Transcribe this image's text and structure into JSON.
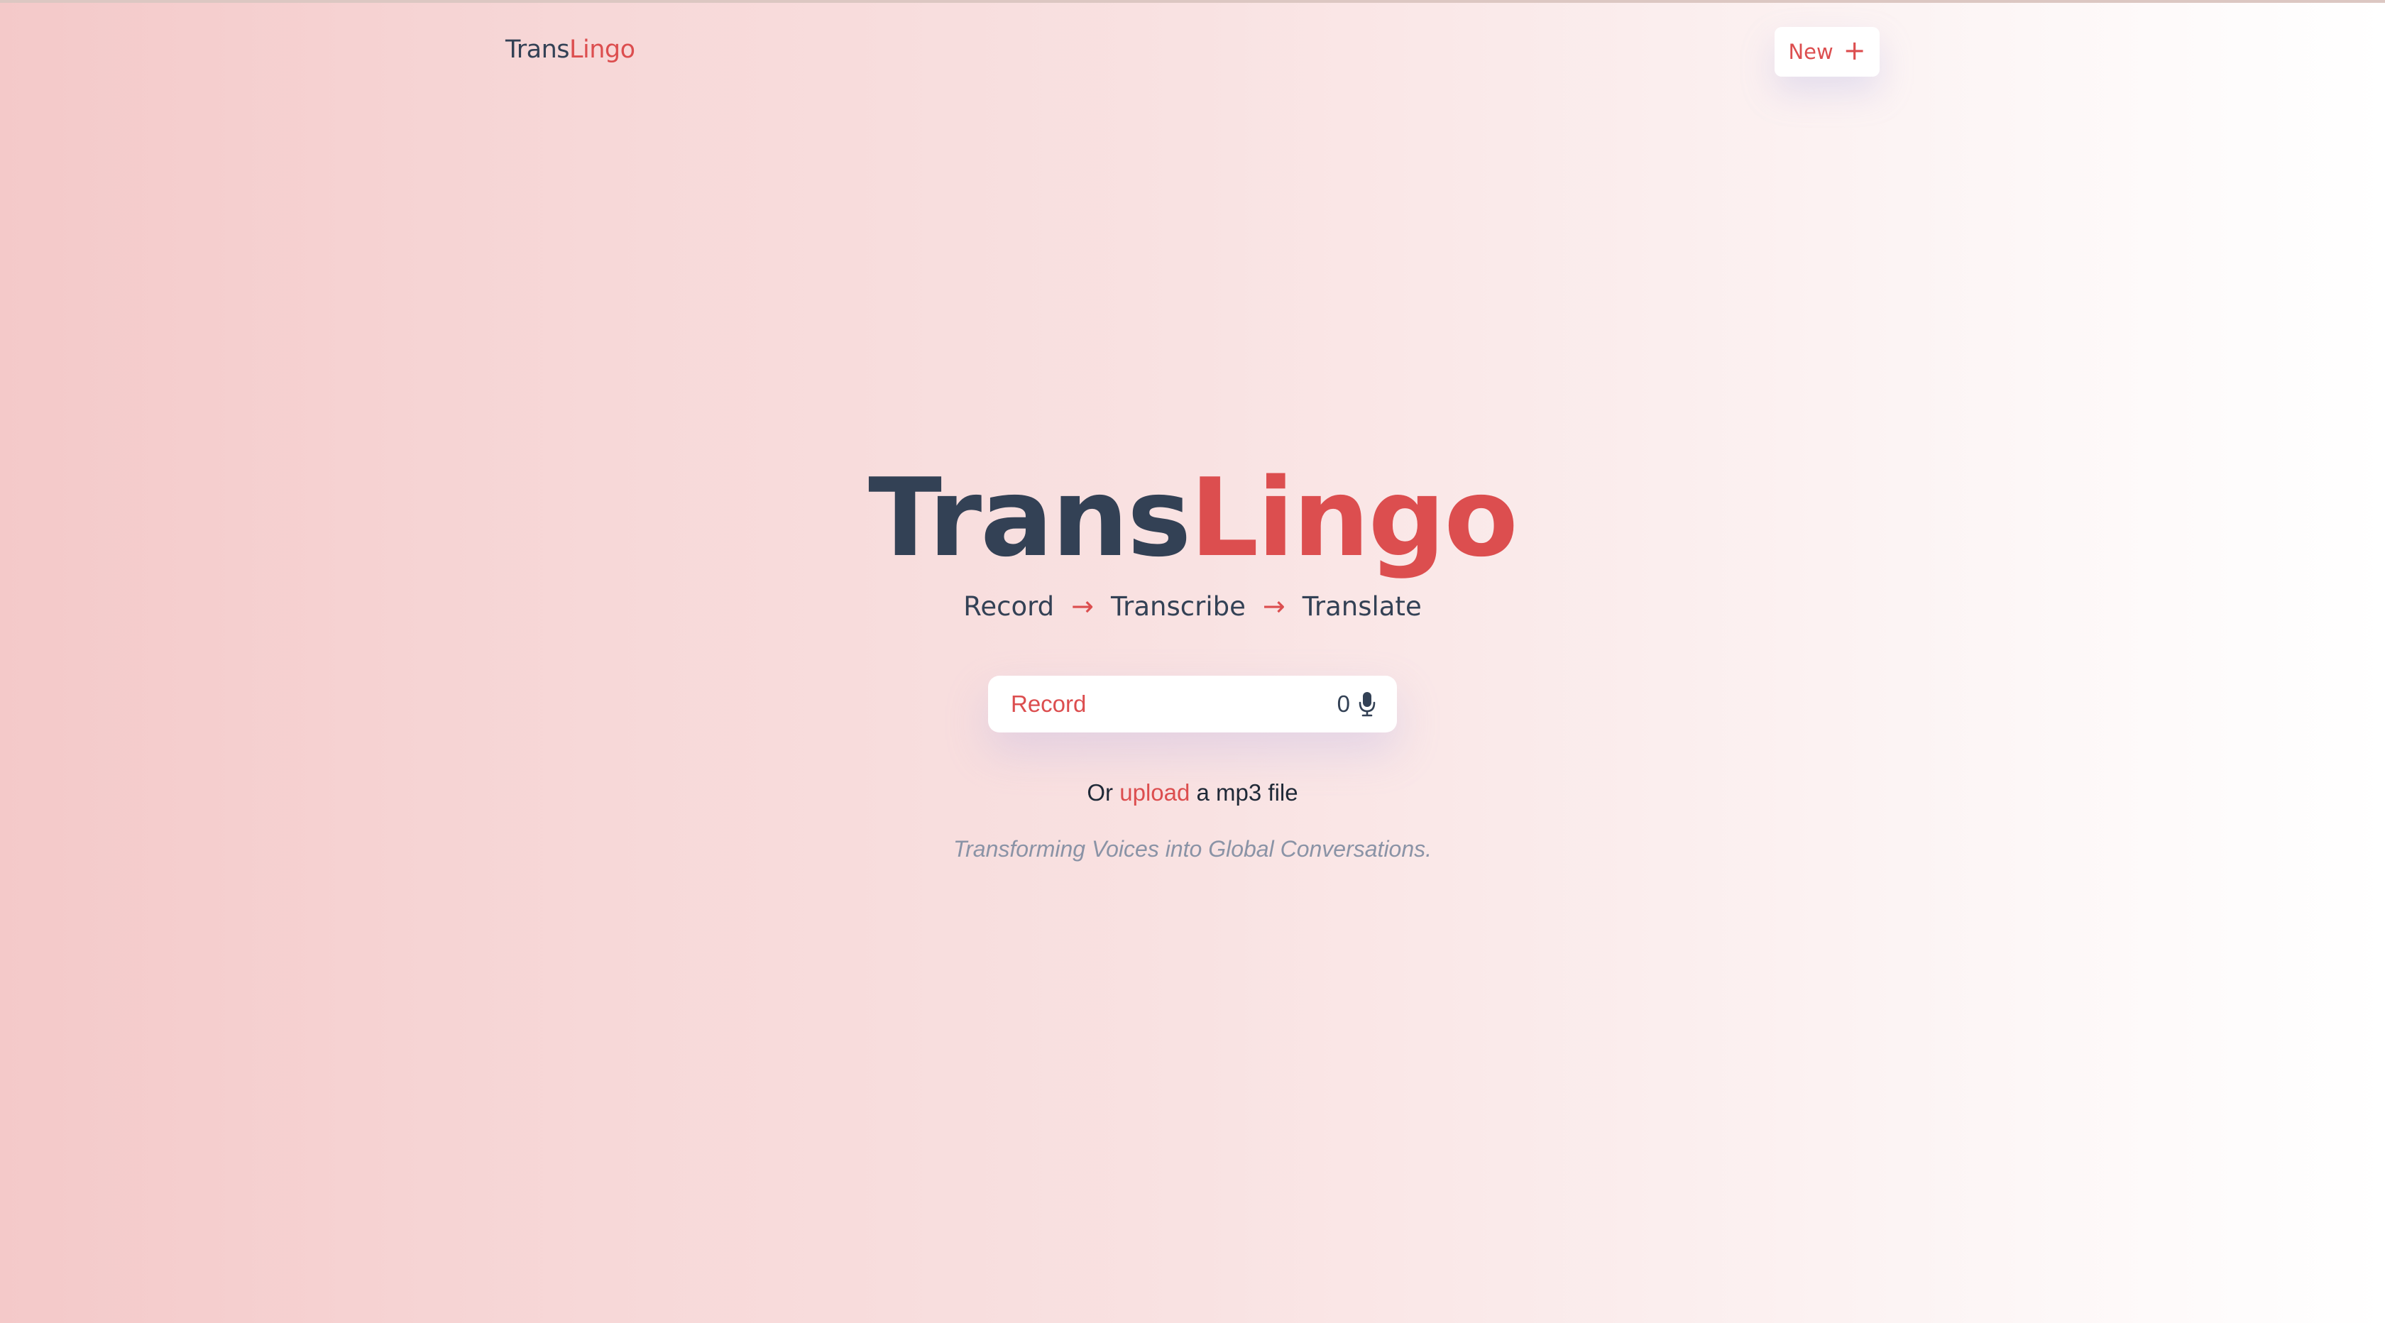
{
  "header": {
    "logo_part1": "Trans",
    "logo_part2": "Lingo",
    "new_button_label": "New",
    "new_button_icon": "plus-icon"
  },
  "hero": {
    "title_part1": "Trans",
    "title_part2": "Lingo",
    "steps": [
      "Record",
      "Transcribe",
      "Translate"
    ],
    "step_separator": "→"
  },
  "recorder": {
    "label": "Record",
    "count": "0",
    "icon": "microphone-icon"
  },
  "upload": {
    "prefix": "Or",
    "link_text": "upload",
    "suffix": "a mp3 file"
  },
  "tagline": "Transforming Voices into Global Conversations.",
  "colors": {
    "accent": "#dc4e4f",
    "dark_text": "#334155",
    "muted_text": "#8a93a6"
  }
}
